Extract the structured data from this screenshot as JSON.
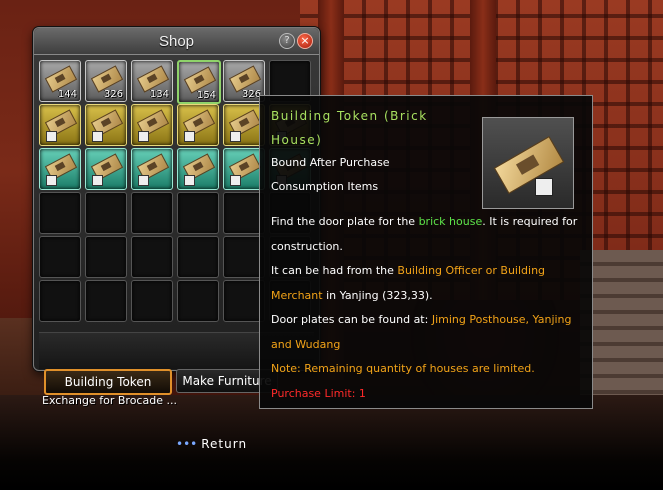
{
  "shop": {
    "title": "Shop",
    "help_label": "?",
    "close_label": "×",
    "rows": [
      [
        {
          "style": "silver",
          "qty": "144"
        },
        {
          "style": "silver",
          "qty": "326"
        },
        {
          "style": "silver",
          "qty": "134"
        },
        {
          "style": "silver",
          "qty": "154",
          "selected": true
        },
        {
          "style": "silver",
          "qty": "326"
        },
        {
          "style": "empty",
          "qty": ""
        }
      ],
      [
        {
          "style": "gold"
        },
        {
          "style": "gold"
        },
        {
          "style": "gold"
        },
        {
          "style": "gold"
        },
        {
          "style": "gold"
        },
        {
          "style": "gold"
        }
      ],
      [
        {
          "style": "teal"
        },
        {
          "style": "teal"
        },
        {
          "style": "teal"
        },
        {
          "style": "teal"
        },
        {
          "style": "teal"
        },
        {
          "style": "teal"
        }
      ],
      [
        {
          "style": "empty"
        },
        {
          "style": "empty"
        },
        {
          "style": "empty"
        },
        {
          "style": "empty"
        },
        {
          "style": "empty"
        },
        {
          "style": "empty"
        }
      ],
      [
        {
          "style": "empty"
        },
        {
          "style": "empty"
        },
        {
          "style": "empty"
        },
        {
          "style": "empty"
        },
        {
          "style": "empty"
        },
        {
          "style": "empty"
        }
      ],
      [
        {
          "style": "empty"
        },
        {
          "style": "empty"
        },
        {
          "style": "empty"
        },
        {
          "style": "empty"
        },
        {
          "style": "empty"
        },
        {
          "style": "empty"
        }
      ]
    ]
  },
  "tabs": {
    "building_token": "Building Token",
    "make_furniture": "Make Furniture",
    "exchange": "Exchange for Brocade ..."
  },
  "footer": {
    "return_dots": "•••",
    "return_label": "Return"
  },
  "tooltip": {
    "title": "Building Token (Brick House)",
    "bind_status": "Bound After Purchase",
    "category": "Consumption Items",
    "desc_1a": "Find the door plate for the ",
    "desc_1b": "brick house",
    "desc_1c": ". It is required for construction.",
    "desc_2a": "It can be had from the ",
    "desc_2b": "Building Officer or Building Merchant",
    "desc_2c": " in Yanjing (323,33).",
    "desc_3a": "Door plates can be found at: ",
    "desc_3b": "Jiming Posthouse, Yanjing and Wudang",
    "note": "Note: Remaining quantity of houses are limited.",
    "limit": "Purchase Limit: 1"
  },
  "colors": {
    "title_green": "#a8e060",
    "highlight_green": "#5ee34a",
    "highlight_orange": "#f2a318",
    "limit_red": "#ff2a2a",
    "active_tab_border": "#e0902a"
  },
  "icons": {
    "item": "building-token-icon",
    "help": "help-icon",
    "close": "close-icon"
  }
}
